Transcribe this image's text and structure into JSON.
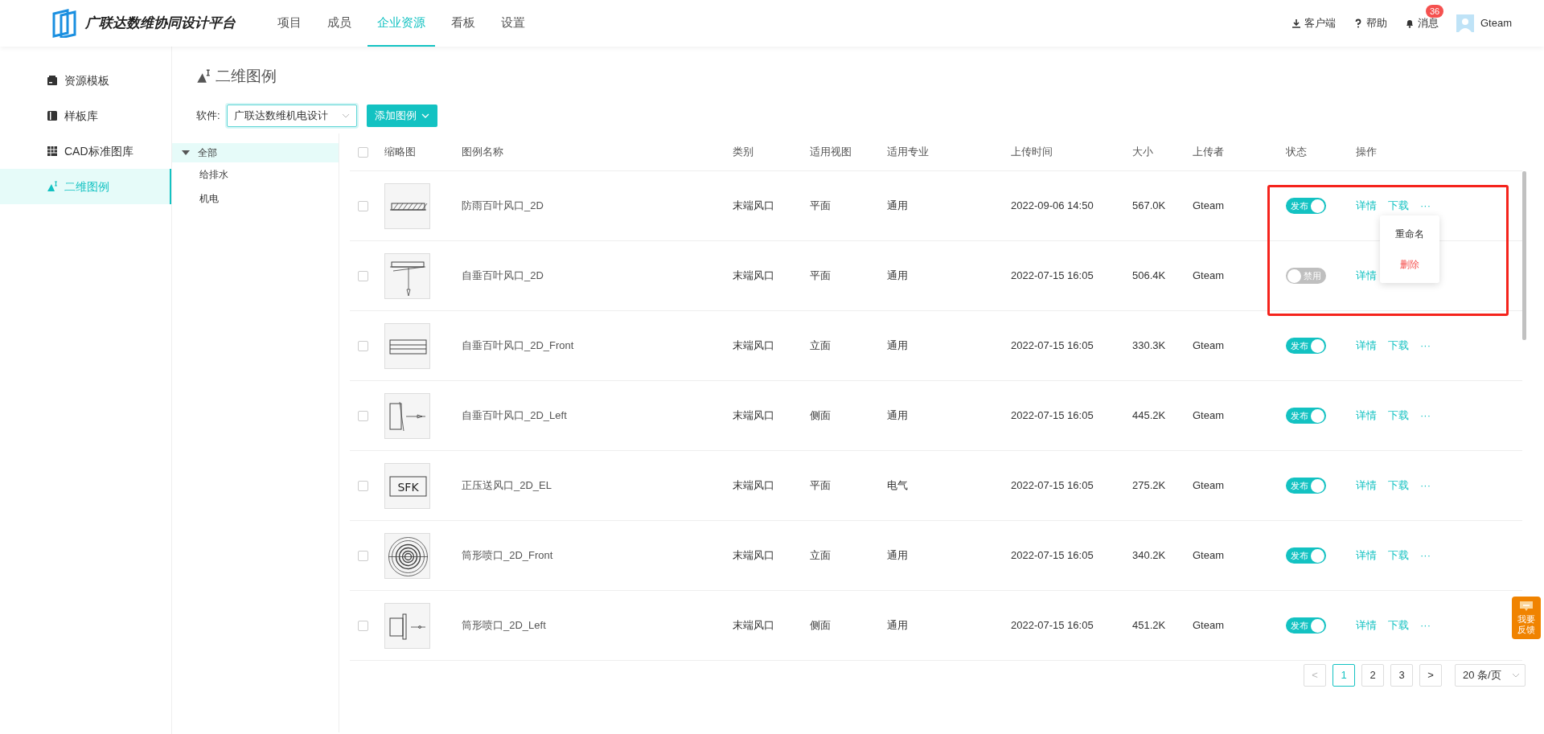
{
  "header": {
    "logo_text": "广联达数维协同设计平台",
    "nav": [
      {
        "label": "项目",
        "selected": false
      },
      {
        "label": "成员",
        "selected": false
      },
      {
        "label": "企业资源",
        "selected": true
      },
      {
        "label": "看板",
        "selected": false
      },
      {
        "label": "设置",
        "selected": false
      }
    ],
    "tools": [
      {
        "kind": "download",
        "label": "客户端"
      },
      {
        "kind": "help",
        "label": "帮助"
      },
      {
        "kind": "bell",
        "label": "消息",
        "badge": "36"
      }
    ],
    "user": "Gteam"
  },
  "sidebar": {
    "items": [
      {
        "label": "资源模板",
        "selected": false
      },
      {
        "label": "样板库",
        "selected": false
      },
      {
        "label": "CAD标准图库",
        "selected": false
      },
      {
        "label": "二维图例",
        "selected": true
      }
    ]
  },
  "page_title": "二维图例",
  "filter": {
    "label": "软件:",
    "value": "广联达数维机电设计",
    "add_button": "添加图例"
  },
  "tree": [
    {
      "label": "全部",
      "expanded": true,
      "selected": true,
      "children": [
        {
          "label": "给排水",
          "selected": false
        },
        {
          "label": "机电",
          "selected": false
        }
      ]
    }
  ],
  "table": {
    "select_all_checked": false,
    "columns": [
      "缩略图",
      "图例名称",
      "类别",
      "适用视图",
      "适用专业",
      "上传时间",
      "大小",
      "上传者",
      "状态",
      "操作"
    ],
    "rows": [
      {
        "checked": false,
        "name": "防雨百叶风口_2D",
        "category": "末端风口",
        "view": "平面",
        "major": "通用",
        "time": "2022-09-06 14:50",
        "size": "567.0K",
        "uploader": "Gteam",
        "published": true,
        "status_label": "发布",
        "actions": [
          "详情",
          "下载",
          "···"
        ]
      },
      {
        "checked": false,
        "name": "自垂百叶风口_2D",
        "category": "末端风口",
        "view": "平面",
        "major": "通用",
        "time": "2022-07-15 16:05",
        "size": "506.4K",
        "uploader": "Gteam",
        "published": false,
        "status_label": "禁用",
        "actions": [
          "详情"
        ]
      },
      {
        "checked": false,
        "name": "自垂百叶风口_2D_Front",
        "category": "末端风口",
        "view": "立面",
        "major": "通用",
        "time": "2022-07-15 16:05",
        "size": "330.3K",
        "uploader": "Gteam",
        "published": true,
        "status_label": "发布",
        "actions": [
          "详情",
          "下载",
          "···"
        ]
      },
      {
        "checked": false,
        "name": "自垂百叶风口_2D_Left",
        "category": "末端风口",
        "view": "侧面",
        "major": "通用",
        "time": "2022-07-15 16:05",
        "size": "445.2K",
        "uploader": "Gteam",
        "published": true,
        "status_label": "发布",
        "actions": [
          "详情",
          "下载",
          "···"
        ]
      },
      {
        "checked": false,
        "thumb_text": "SFK",
        "name": "正压送风口_2D_EL",
        "category": "末端风口",
        "view": "平面",
        "major": "电气",
        "time": "2022-07-15 16:05",
        "size": "275.2K",
        "uploader": "Gteam",
        "published": true,
        "status_label": "发布",
        "actions": [
          "详情",
          "下载",
          "···"
        ]
      },
      {
        "checked": false,
        "name": "筒形喷口_2D_Front",
        "category": "末端风口",
        "view": "立面",
        "major": "通用",
        "time": "2022-07-15 16:05",
        "size": "340.2K",
        "uploader": "Gteam",
        "published": true,
        "status_label": "发布",
        "actions": [
          "详情",
          "下载",
          "···"
        ]
      },
      {
        "checked": false,
        "name": "筒形喷口_2D_Left",
        "category": "末端风口",
        "view": "侧面",
        "major": "通用",
        "time": "2022-07-15 16:05",
        "size": "451.2K",
        "uploader": "Gteam",
        "published": true,
        "status_label": "发布",
        "actions": [
          "详情",
          "下载",
          "···"
        ]
      }
    ]
  },
  "row_menu": {
    "items": [
      {
        "label": "重命名",
        "kind": "normal"
      },
      {
        "label": "删除",
        "kind": "danger"
      }
    ]
  },
  "pagination": {
    "prev": "<",
    "next": ">",
    "pages": [
      {
        "label": "1",
        "selected": true
      },
      {
        "label": "2",
        "selected": false
      },
      {
        "label": "3",
        "selected": false
      }
    ],
    "page_size": "20 条/页"
  },
  "feedback": "我要反馈",
  "annotation_frame": true
}
